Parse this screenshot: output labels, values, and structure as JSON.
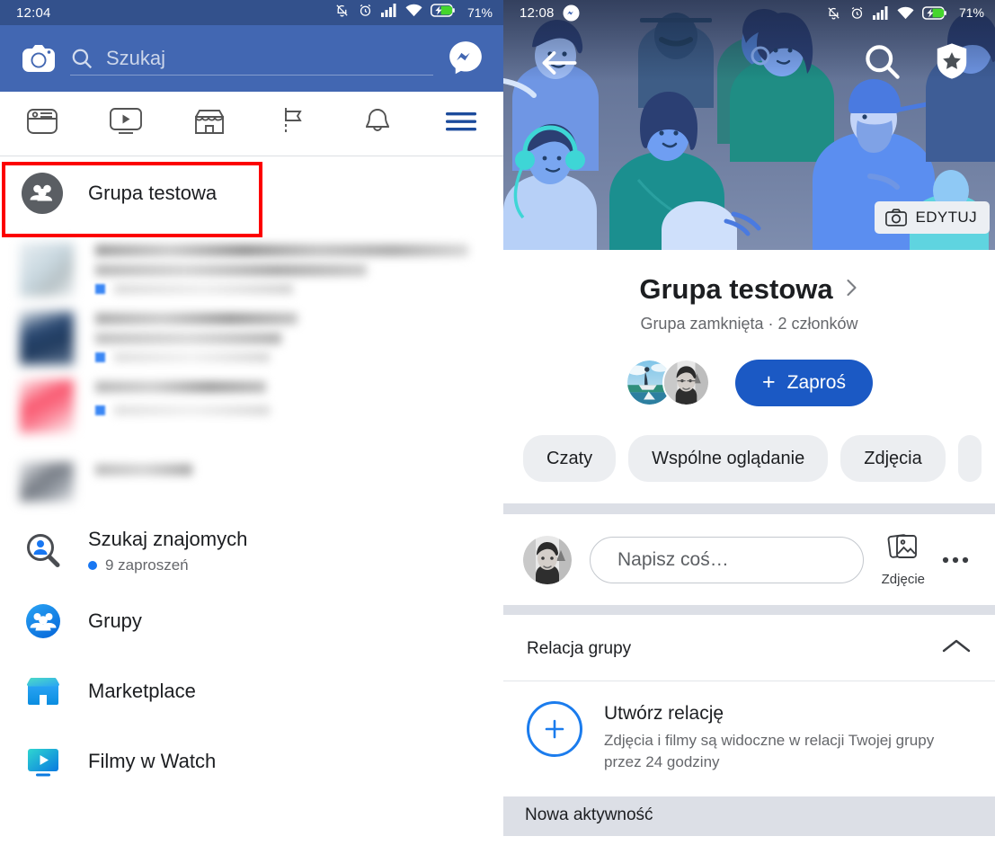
{
  "left": {
    "status": {
      "time": "12:04",
      "battery_pct": "71%",
      "icons": [
        "bell-muted-icon",
        "alarm-icon",
        "signal-icon",
        "wifi-icon",
        "battery-charging-icon"
      ]
    },
    "topbar": {
      "camera_icon": "camera-icon",
      "search_placeholder": "Szukaj",
      "search_icon": "search-icon",
      "messenger_icon": "messenger-icon"
    },
    "tabs": [
      {
        "name": "tab-news-feed",
        "icon": "news-feed-icon"
      },
      {
        "name": "tab-watch",
        "icon": "video-play-icon"
      },
      {
        "name": "tab-marketplace",
        "icon": "storefront-icon"
      },
      {
        "name": "tab-groups",
        "icon": "flag-icon"
      },
      {
        "name": "tab-notifications",
        "icon": "bell-icon"
      },
      {
        "name": "tab-menu",
        "icon": "hamburger-icon"
      }
    ],
    "group_suggestion": {
      "label": "Grupa testowa",
      "icon": "group-people-icon"
    },
    "menu": [
      {
        "label": "Szukaj znajomych",
        "sub": "9 zaproszeń",
        "icon": "find-friends-icon"
      },
      {
        "label": "Grupy",
        "sub": "",
        "icon": "groups-icon"
      },
      {
        "label": "Marketplace",
        "sub": "",
        "icon": "marketplace-icon"
      },
      {
        "label": "Filmy w Watch",
        "sub": "",
        "icon": "watch-icon"
      }
    ]
  },
  "right": {
    "status": {
      "time": "12:08",
      "battery_pct": "71%",
      "messenger_icon": "messenger-icon",
      "icons": [
        "bell-muted-icon",
        "alarm-icon",
        "signal-icon",
        "wifi-icon",
        "battery-charging-icon"
      ]
    },
    "cover": {
      "back_icon": "back-arrow-icon",
      "search_icon": "search-icon",
      "shield_icon": "shield-star-icon",
      "edit_label": "EDYTUJ",
      "edit_icon": "camera-icon"
    },
    "group": {
      "title": "Grupa testowa",
      "chevron_icon": "chevron-right-icon",
      "subtitle": "Grupa zamknięta · 2 członków",
      "invite_label": "Zaproś",
      "invite_plus": "+",
      "member_avatars": [
        "avatar-beach",
        "avatar-portrait"
      ]
    },
    "chips": [
      "Czaty",
      "Wspólne oglądanie",
      "Zdjęcia"
    ],
    "composer": {
      "avatar": "avatar-portrait",
      "placeholder": "Napisz coś…",
      "photo_label": "Zdjęcie",
      "photo_icon": "photo-stack-icon",
      "more_icon": "ellipsis-icon"
    },
    "story_section": {
      "heading": "Relacja grupy",
      "collapse_icon": "chevron-up-icon",
      "create_title": "Utwórz relację",
      "create_desc": "Zdjęcia i filmy są widoczne w relacji Twojej grupy przez 24 godziny",
      "plus_icon": "plus-icon"
    },
    "footer": {
      "label": "Nowa aktywność"
    }
  },
  "colors": {
    "fb_blue": "#4267b2",
    "statusbar_blue": "#33518c",
    "accent_blue": "#1877f2",
    "invite_blue": "#1b59c4",
    "highlight_red": "#fc0000",
    "band_gray": "#dcdfe6",
    "text_primary": "#1c1e21",
    "text_secondary": "#65676b"
  }
}
